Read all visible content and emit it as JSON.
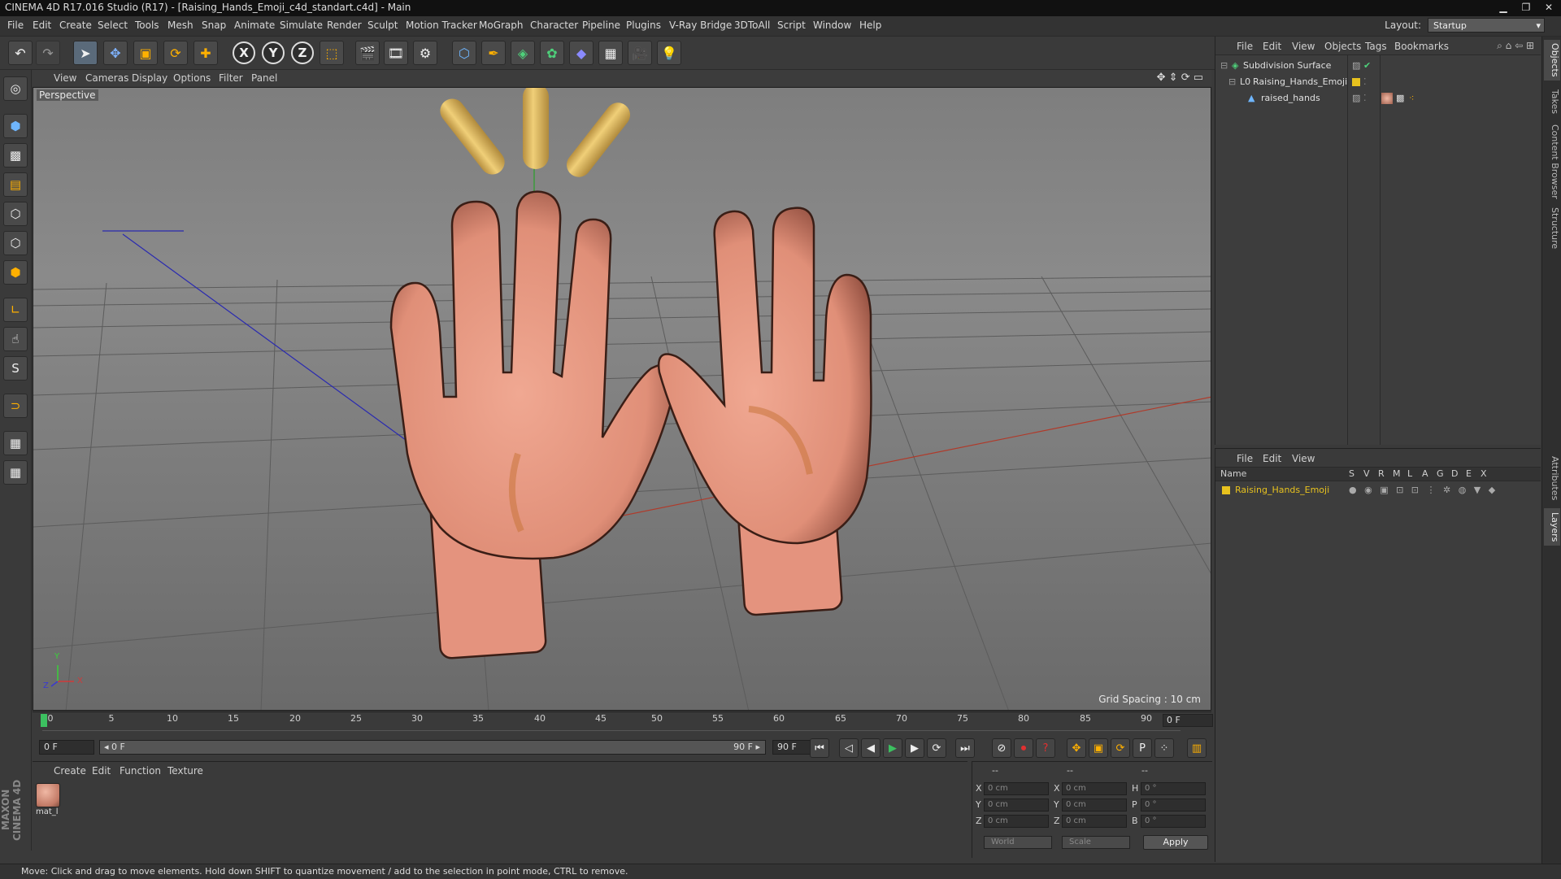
{
  "window": {
    "title": "CINEMA 4D R17.016 Studio (R17) - [Raising_Hands_Emoji_c4d_standart.c4d] - Main",
    "minimize": "▁",
    "maximize": "❐",
    "close": "✕"
  },
  "menubar": {
    "items": [
      "File",
      "Edit",
      "Create",
      "Select",
      "Tools",
      "Mesh",
      "Snap",
      "Animate",
      "Simulate",
      "Render",
      "Sculpt",
      "Motion Tracker",
      "MoGraph",
      "Character",
      "Pipeline",
      "Plugins",
      "V-Ray Bridge",
      "3DToAll",
      "Script",
      "Window",
      "Help"
    ],
    "layout_label": "Layout:",
    "layout_value": "Startup"
  },
  "viewport": {
    "menu": [
      "View",
      "Cameras",
      "Display",
      "Options",
      "Filter",
      "Panel"
    ],
    "label": "Perspective",
    "grid_spacing": "Grid Spacing : 10 cm",
    "axis_y": "Y",
    "axis_x": "X",
    "axis_z": "Z"
  },
  "timeline": {
    "ticks": [
      "0",
      "5",
      "10",
      "15",
      "20",
      "25",
      "30",
      "35",
      "40",
      "45",
      "50",
      "55",
      "60",
      "65",
      "70",
      "75",
      "80",
      "85",
      "90"
    ],
    "current_frame": "0 F"
  },
  "transport": {
    "start_field": "0 F",
    "range_start": "◂ 0 F",
    "range_end": "90 F ▸",
    "end_field": "90 F"
  },
  "materials": {
    "menu": [
      "Create",
      "Edit",
      "Function",
      "Texture"
    ],
    "items": [
      {
        "name": "mat_l"
      }
    ]
  },
  "coords": {
    "header": [
      "--",
      "--",
      "--"
    ],
    "rows": [
      {
        "a": "X",
        "av": "0 cm",
        "b": "X",
        "bv": "0 cm",
        "c": "H",
        "cv": "0 °"
      },
      {
        "a": "Y",
        "av": "0 cm",
        "b": "Y",
        "bv": "0 cm",
        "c": "P",
        "cv": "0 °"
      },
      {
        "a": "Z",
        "av": "0 cm",
        "b": "Z",
        "bv": "0 cm",
        "c": "B",
        "cv": "0 °"
      }
    ],
    "mode1": "World",
    "mode2": "Scale",
    "apply": "Apply"
  },
  "objects": {
    "menu": [
      "File",
      "Edit",
      "View",
      "Objects",
      "Tags",
      "Bookmarks"
    ],
    "rows": [
      {
        "name": "Subdivision Surface"
      },
      {
        "name": "Raising_Hands_Emoji"
      },
      {
        "name": "raised_hands"
      }
    ]
  },
  "layers": {
    "menu": [
      "File",
      "Edit",
      "View"
    ],
    "columns": [
      "Name",
      "S",
      "V",
      "R",
      "M",
      "L",
      "A",
      "G",
      "D",
      "E",
      "X"
    ],
    "rows": [
      {
        "name": "Raising_Hands_Emoji"
      }
    ]
  },
  "side_tabs": [
    "Objects",
    "Takes",
    "Content Browser",
    "Structure",
    "Attributes",
    "Layers"
  ],
  "status": "Move: Click and drag to move elements. Hold down SHIFT to quantize movement / add to the selection in point mode, CTRL to remove.",
  "maxon_logo": "MAXON CINEMA 4D",
  "colors": {
    "skin": "#e89a84",
    "accent_yellow": "#e6c36a",
    "layer_color": "#e8c21e"
  }
}
